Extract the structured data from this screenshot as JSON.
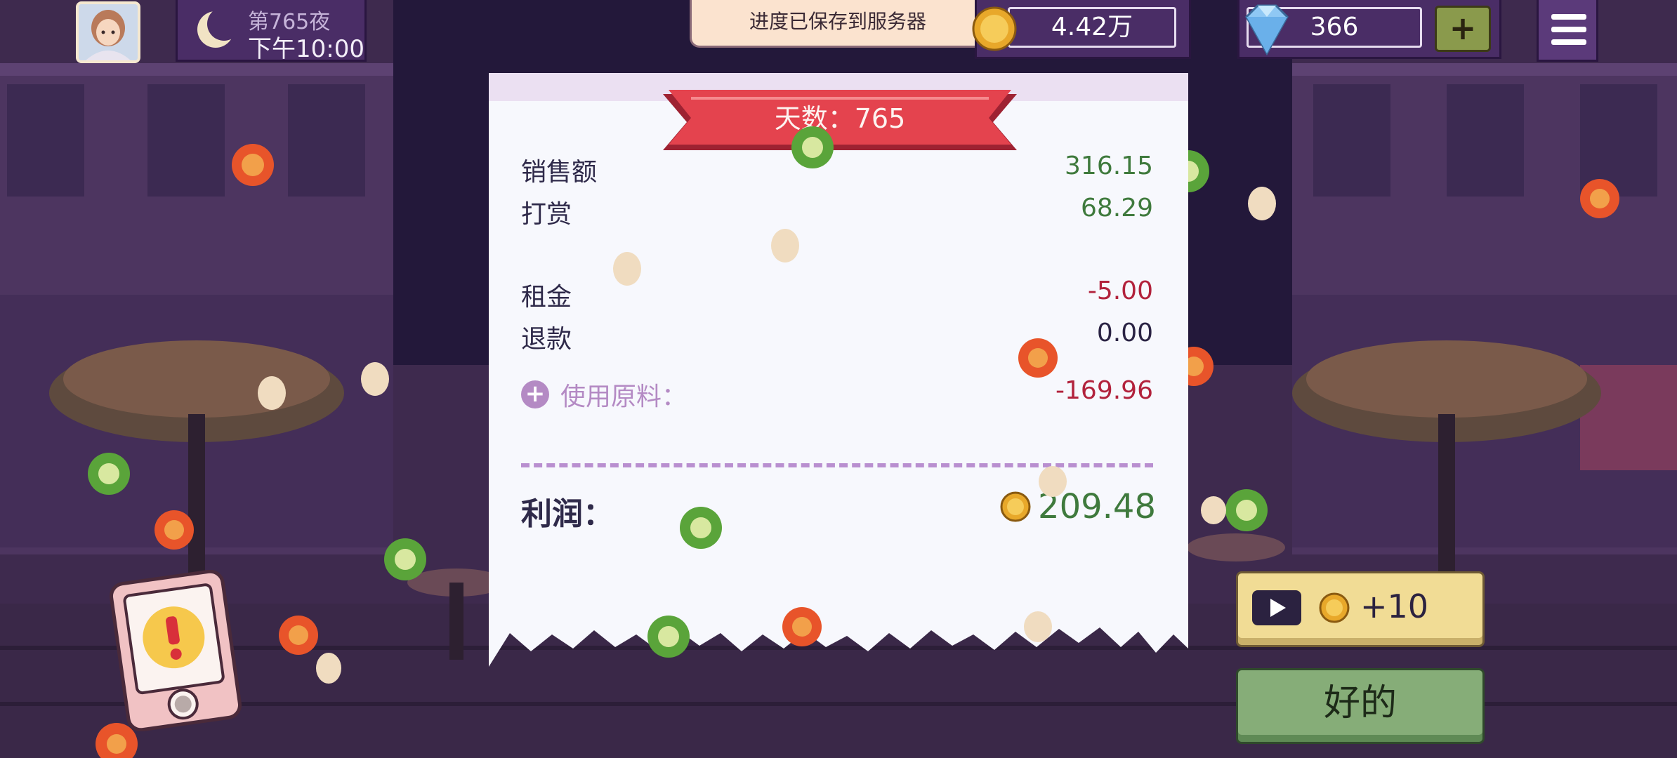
{
  "hud": {
    "day_label": "第765夜",
    "time": "下午10:00",
    "toast": "进度已保存到服务器",
    "coins": "4.42万",
    "gems": "366",
    "gem_plus": "+"
  },
  "receipt": {
    "ribbon_title": "天数：765",
    "rows": [
      {
        "label": "销售额",
        "value": "316.15"
      },
      {
        "label": "打赏",
        "value": "68.29"
      },
      {
        "label": "租金",
        "value": "-5.00"
      },
      {
        "label": "退款",
        "value": "0.00"
      },
      {
        "label": "使用原料：",
        "value": "-169.96"
      }
    ],
    "profit_label": "利润：",
    "profit_value": "209.48"
  },
  "buttons": {
    "ad_reward": "+10",
    "ok": "好的"
  },
  "colors": {
    "positive": "#3f7a3d",
    "negative": "#b2223c",
    "neutral": "#2a2344",
    "accent_purple": "#b48ac4"
  },
  "icons": [
    "moon-icon",
    "coin-icon",
    "gem-icon",
    "menu-icon",
    "play-icon",
    "alert-icon",
    "add-icon"
  ]
}
